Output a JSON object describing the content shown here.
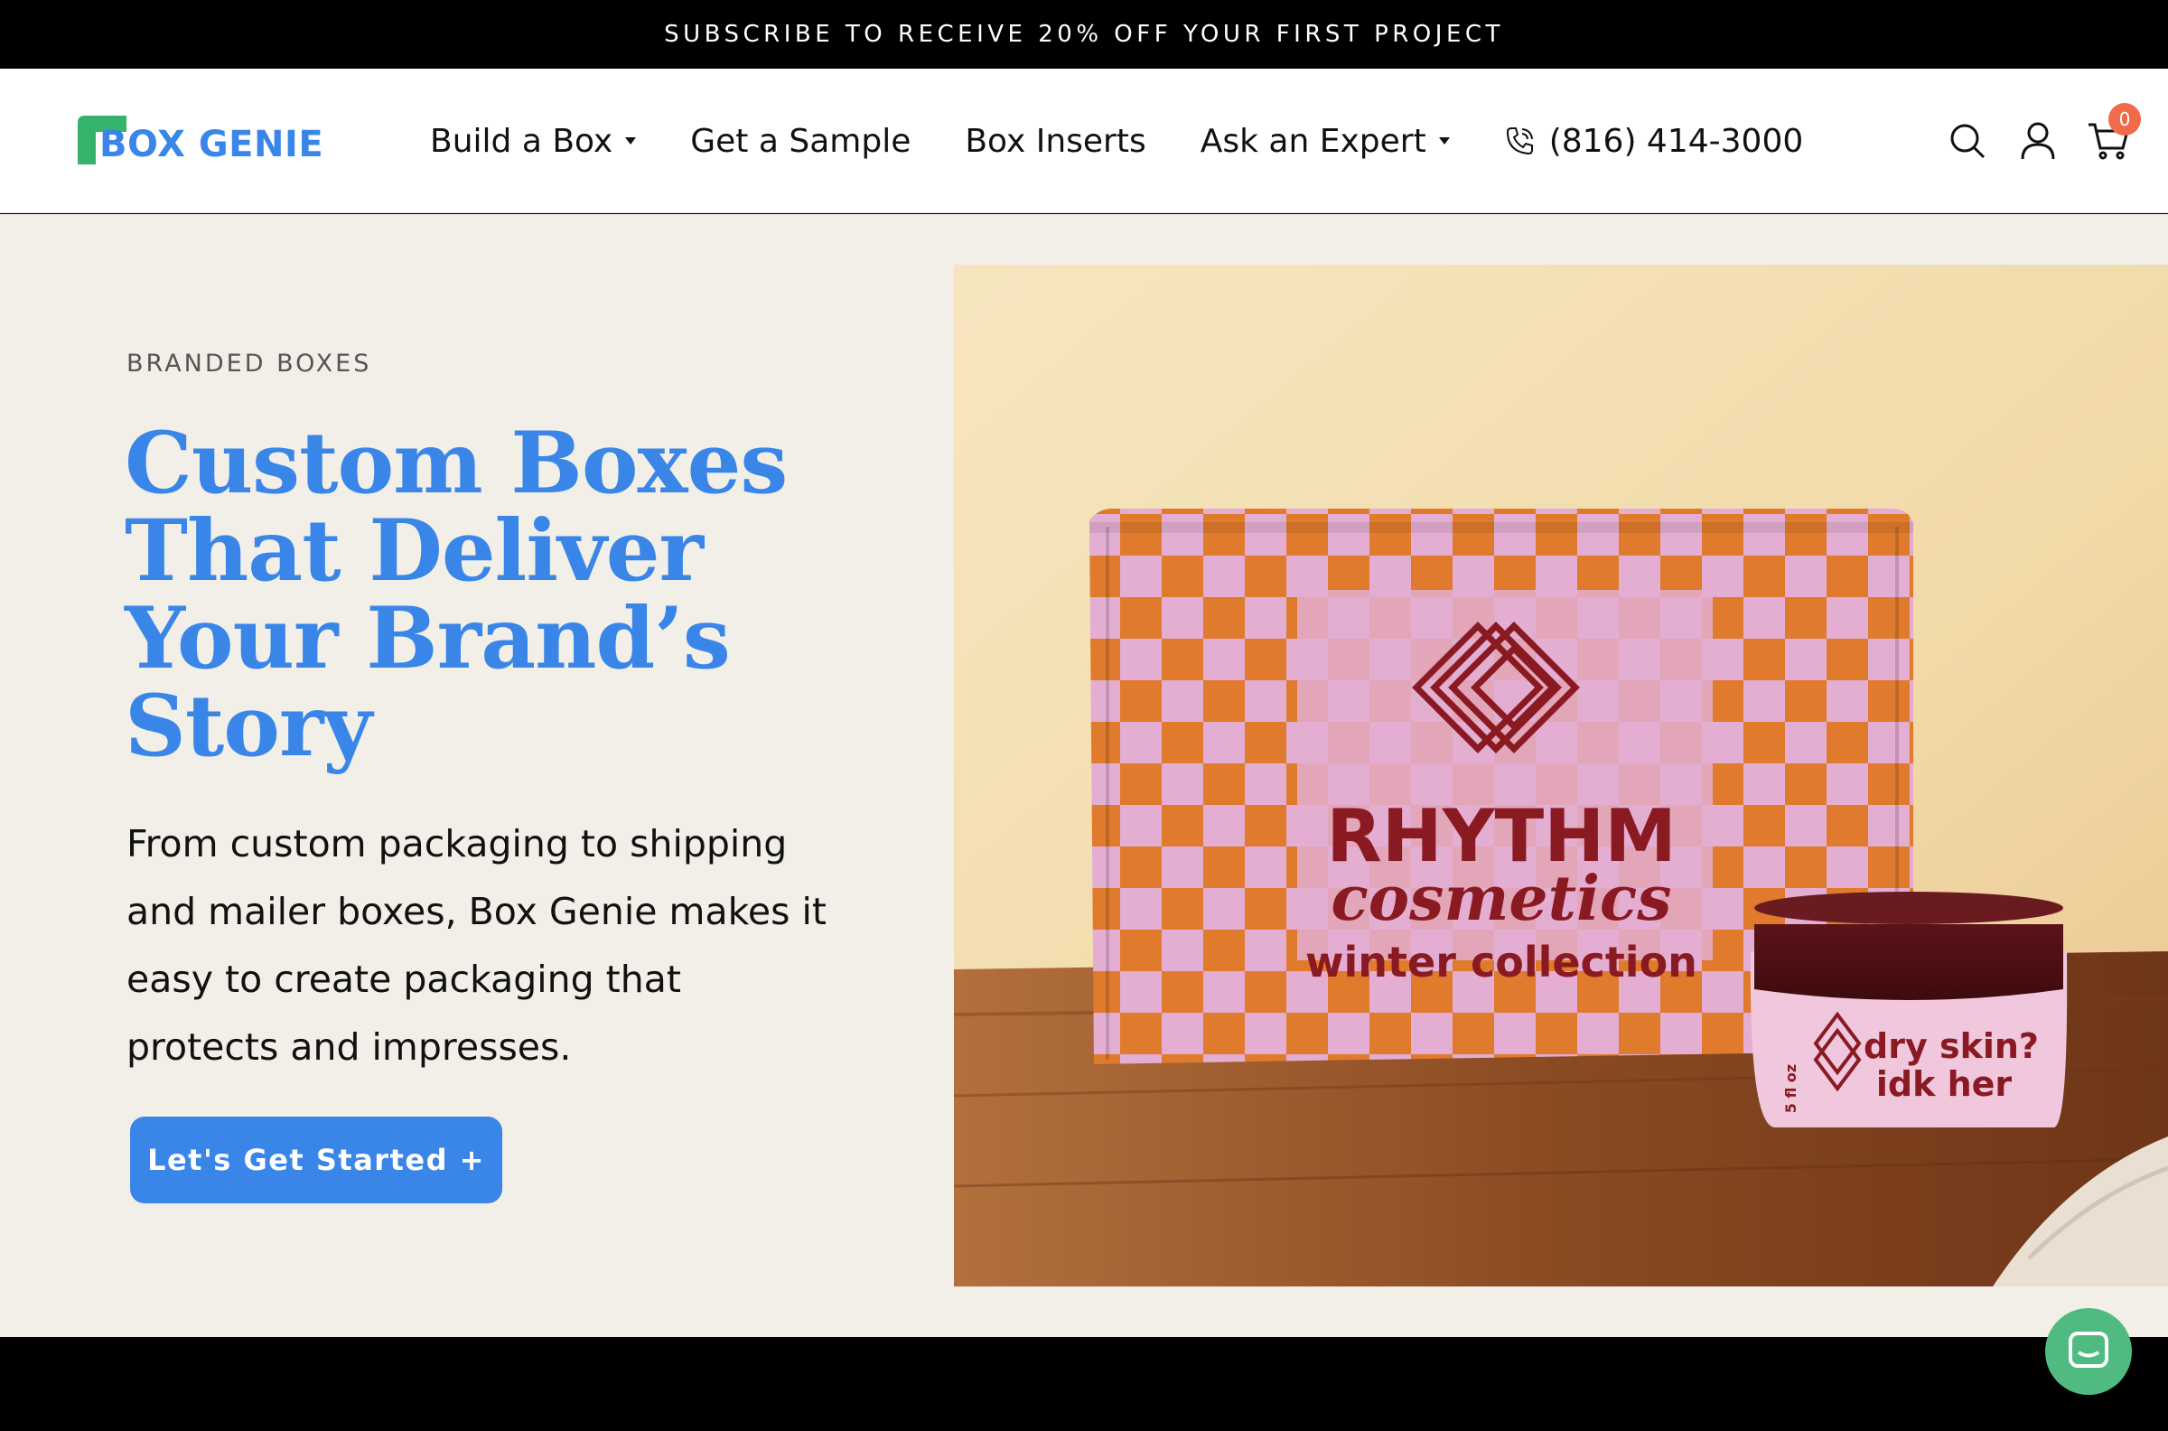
{
  "announcement": "SUBSCRIBE TO RECEIVE 20% OFF YOUR FIRST PROJECT",
  "brand": {
    "name": "BOX GENIE",
    "green": "#33b36b",
    "blue": "#3a86e8"
  },
  "nav": {
    "items": [
      {
        "label": "Build a Box",
        "has_dropdown": true
      },
      {
        "label": "Get a Sample",
        "has_dropdown": false
      },
      {
        "label": "Box Inserts",
        "has_dropdown": false
      },
      {
        "label": "Ask an Expert",
        "has_dropdown": true
      }
    ],
    "phone": "(816) 414-3000"
  },
  "header_icons": {
    "search": "search-icon",
    "account": "user-icon",
    "cart": "cart-icon",
    "cart_count": "0"
  },
  "hero": {
    "eyebrow": "BRANDED BOXES",
    "headline_lines": [
      "Custom Boxes",
      "That Deliver",
      "Your Brand’s",
      "Story"
    ],
    "body": "From custom packaging to shipping and mailer boxes, Box Genie makes it easy to create packaging that protects and impresses.",
    "cta": "Let's Get Started +"
  },
  "product_photo": {
    "box_brand": "RHYTHM",
    "box_script": "cosmetics",
    "box_sub": "winter collection",
    "jar_size": "5 fl oz",
    "jar_line1": "dry skin?",
    "jar_line2": "idk her"
  },
  "colors": {
    "hero_bg": "#f1efe7",
    "accent": "#3a86e8",
    "cta_text": "#ffffff",
    "cart_badge": "#ef6b4a",
    "chat": "#4fbb80"
  }
}
